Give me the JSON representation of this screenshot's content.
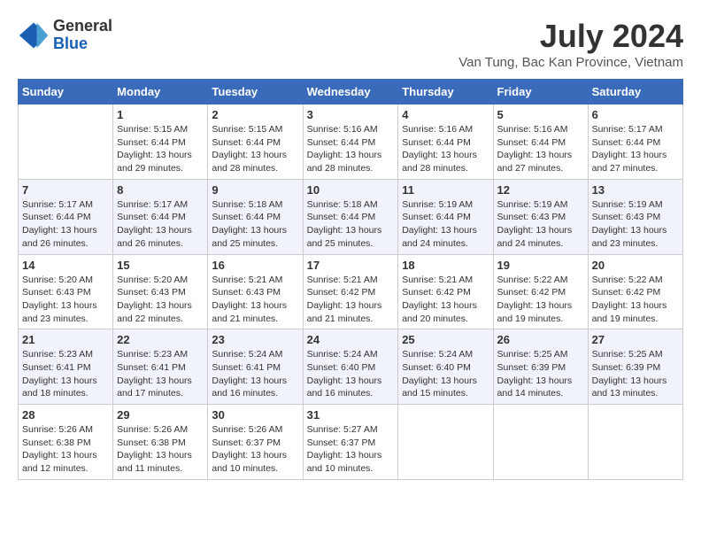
{
  "header": {
    "logo_line1": "General",
    "logo_line2": "Blue",
    "month_year": "July 2024",
    "location": "Van Tung, Bac Kan Province, Vietnam"
  },
  "days_of_week": [
    "Sunday",
    "Monday",
    "Tuesday",
    "Wednesday",
    "Thursday",
    "Friday",
    "Saturday"
  ],
  "weeks": [
    [
      {
        "num": "",
        "detail": ""
      },
      {
        "num": "1",
        "detail": "Sunrise: 5:15 AM\nSunset: 6:44 PM\nDaylight: 13 hours\nand 29 minutes."
      },
      {
        "num": "2",
        "detail": "Sunrise: 5:15 AM\nSunset: 6:44 PM\nDaylight: 13 hours\nand 28 minutes."
      },
      {
        "num": "3",
        "detail": "Sunrise: 5:16 AM\nSunset: 6:44 PM\nDaylight: 13 hours\nand 28 minutes."
      },
      {
        "num": "4",
        "detail": "Sunrise: 5:16 AM\nSunset: 6:44 PM\nDaylight: 13 hours\nand 28 minutes."
      },
      {
        "num": "5",
        "detail": "Sunrise: 5:16 AM\nSunset: 6:44 PM\nDaylight: 13 hours\nand 27 minutes."
      },
      {
        "num": "6",
        "detail": "Sunrise: 5:17 AM\nSunset: 6:44 PM\nDaylight: 13 hours\nand 27 minutes."
      }
    ],
    [
      {
        "num": "7",
        "detail": "Sunrise: 5:17 AM\nSunset: 6:44 PM\nDaylight: 13 hours\nand 26 minutes."
      },
      {
        "num": "8",
        "detail": "Sunrise: 5:17 AM\nSunset: 6:44 PM\nDaylight: 13 hours\nand 26 minutes."
      },
      {
        "num": "9",
        "detail": "Sunrise: 5:18 AM\nSunset: 6:44 PM\nDaylight: 13 hours\nand 25 minutes."
      },
      {
        "num": "10",
        "detail": "Sunrise: 5:18 AM\nSunset: 6:44 PM\nDaylight: 13 hours\nand 25 minutes."
      },
      {
        "num": "11",
        "detail": "Sunrise: 5:19 AM\nSunset: 6:44 PM\nDaylight: 13 hours\nand 24 minutes."
      },
      {
        "num": "12",
        "detail": "Sunrise: 5:19 AM\nSunset: 6:43 PM\nDaylight: 13 hours\nand 24 minutes."
      },
      {
        "num": "13",
        "detail": "Sunrise: 5:19 AM\nSunset: 6:43 PM\nDaylight: 13 hours\nand 23 minutes."
      }
    ],
    [
      {
        "num": "14",
        "detail": "Sunrise: 5:20 AM\nSunset: 6:43 PM\nDaylight: 13 hours\nand 23 minutes."
      },
      {
        "num": "15",
        "detail": "Sunrise: 5:20 AM\nSunset: 6:43 PM\nDaylight: 13 hours\nand 22 minutes."
      },
      {
        "num": "16",
        "detail": "Sunrise: 5:21 AM\nSunset: 6:43 PM\nDaylight: 13 hours\nand 21 minutes."
      },
      {
        "num": "17",
        "detail": "Sunrise: 5:21 AM\nSunset: 6:42 PM\nDaylight: 13 hours\nand 21 minutes."
      },
      {
        "num": "18",
        "detail": "Sunrise: 5:21 AM\nSunset: 6:42 PM\nDaylight: 13 hours\nand 20 minutes."
      },
      {
        "num": "19",
        "detail": "Sunrise: 5:22 AM\nSunset: 6:42 PM\nDaylight: 13 hours\nand 19 minutes."
      },
      {
        "num": "20",
        "detail": "Sunrise: 5:22 AM\nSunset: 6:42 PM\nDaylight: 13 hours\nand 19 minutes."
      }
    ],
    [
      {
        "num": "21",
        "detail": "Sunrise: 5:23 AM\nSunset: 6:41 PM\nDaylight: 13 hours\nand 18 minutes."
      },
      {
        "num": "22",
        "detail": "Sunrise: 5:23 AM\nSunset: 6:41 PM\nDaylight: 13 hours\nand 17 minutes."
      },
      {
        "num": "23",
        "detail": "Sunrise: 5:24 AM\nSunset: 6:41 PM\nDaylight: 13 hours\nand 16 minutes."
      },
      {
        "num": "24",
        "detail": "Sunrise: 5:24 AM\nSunset: 6:40 PM\nDaylight: 13 hours\nand 16 minutes."
      },
      {
        "num": "25",
        "detail": "Sunrise: 5:24 AM\nSunset: 6:40 PM\nDaylight: 13 hours\nand 15 minutes."
      },
      {
        "num": "26",
        "detail": "Sunrise: 5:25 AM\nSunset: 6:39 PM\nDaylight: 13 hours\nand 14 minutes."
      },
      {
        "num": "27",
        "detail": "Sunrise: 5:25 AM\nSunset: 6:39 PM\nDaylight: 13 hours\nand 13 minutes."
      }
    ],
    [
      {
        "num": "28",
        "detail": "Sunrise: 5:26 AM\nSunset: 6:38 PM\nDaylight: 13 hours\nand 12 minutes."
      },
      {
        "num": "29",
        "detail": "Sunrise: 5:26 AM\nSunset: 6:38 PM\nDaylight: 13 hours\nand 11 minutes."
      },
      {
        "num": "30",
        "detail": "Sunrise: 5:26 AM\nSunset: 6:37 PM\nDaylight: 13 hours\nand 10 minutes."
      },
      {
        "num": "31",
        "detail": "Sunrise: 5:27 AM\nSunset: 6:37 PM\nDaylight: 13 hours\nand 10 minutes."
      },
      {
        "num": "",
        "detail": ""
      },
      {
        "num": "",
        "detail": ""
      },
      {
        "num": "",
        "detail": ""
      }
    ]
  ]
}
